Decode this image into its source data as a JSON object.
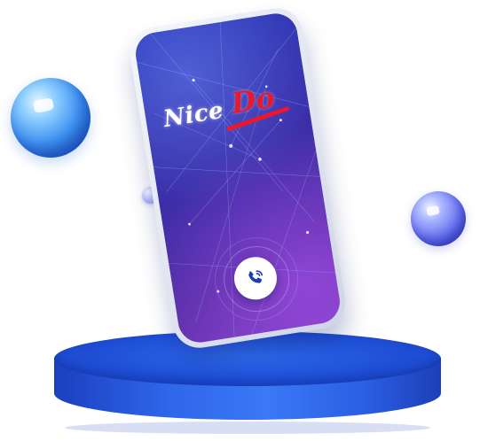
{
  "logo": {
    "word_nice": "Nice",
    "word_do": "Do"
  },
  "colors": {
    "logo_red": "#e8192c",
    "screen_blue": "#2836b8",
    "screen_purple": "#7a3cbf",
    "podium_blue": "#2f67ea",
    "call_icon_blue": "#1c3fae"
  },
  "icons": {
    "call": "phone-call-icon"
  }
}
